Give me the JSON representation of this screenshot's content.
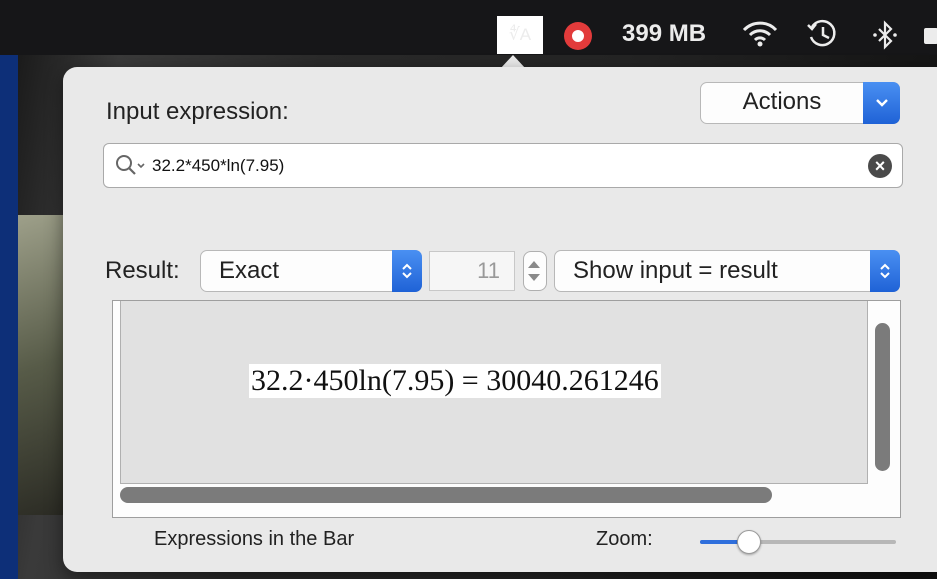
{
  "menubar": {
    "app_icon_text": "∜A",
    "memory": "399 MB",
    "icons": [
      "app-icon",
      "record-icon",
      "wifi-icon",
      "time-machine-icon",
      "bluetooth-icon"
    ]
  },
  "popover": {
    "input_label": "Input expression:",
    "actions_label": "Actions",
    "search": {
      "value": "32.2*450*ln(7.95)",
      "placeholder": ""
    },
    "result_label": "Result:",
    "mode_select": "Exact",
    "precision": "11",
    "display_select": "Show input = result",
    "result_text": "32.2·450ln(7.95) = 30040.261246",
    "footer_label": "Expressions in the Bar",
    "zoom_label": "Zoom:",
    "zoom_level": 0.25
  },
  "colors": {
    "accent": "#1f62d6",
    "menubar": "#161618",
    "desktop": "#0d2f78"
  }
}
